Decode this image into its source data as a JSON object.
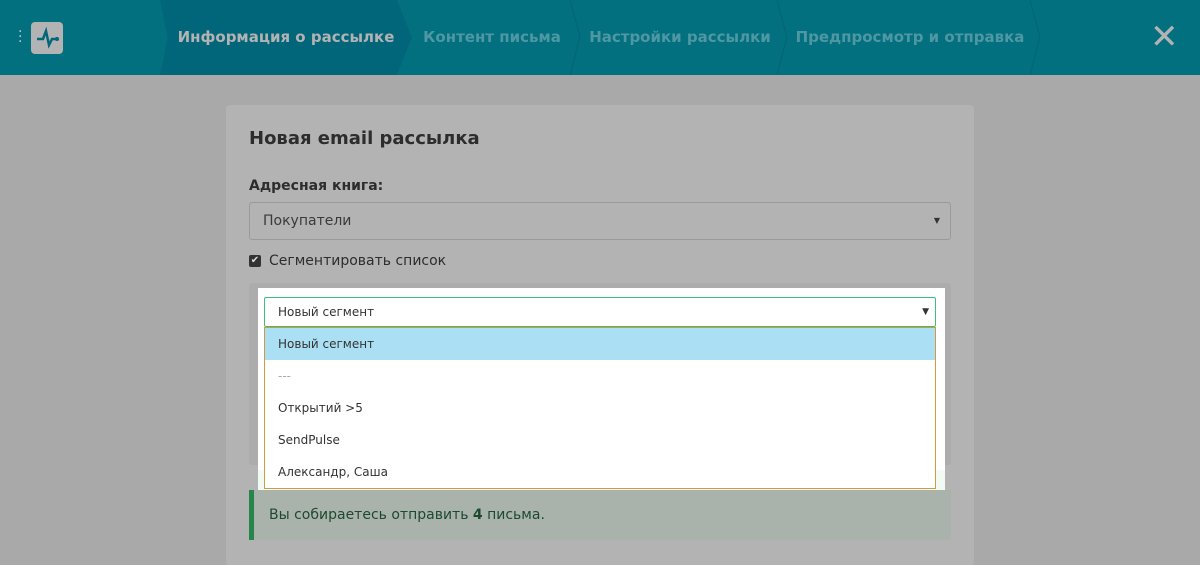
{
  "header": {
    "steps": [
      "Информация о рассылке",
      "Контент письма",
      "Настройки рассылки",
      "Предпросмотр и отправка"
    ],
    "active_step": 0
  },
  "card": {
    "title": "Новая email рассылка",
    "address_book_label": "Адресная книга:",
    "address_book_value": "Покупатели",
    "segment_checkbox_label": "Сегментировать список",
    "segment_checked": true,
    "segment_select_value": "Новый сегмент",
    "segment_options": [
      "Новый сегмент",
      "---",
      "Открытий >5",
      "SendPulse",
      "Александр, Саша"
    ],
    "alert_prefix": "Вы собираетесь отправить ",
    "alert_count": "4",
    "alert_suffix": " письма."
  },
  "colors": {
    "header": "#03707f",
    "active_step": "#02667a",
    "highlight": "#abdff4",
    "alert_border": "#25854b"
  }
}
